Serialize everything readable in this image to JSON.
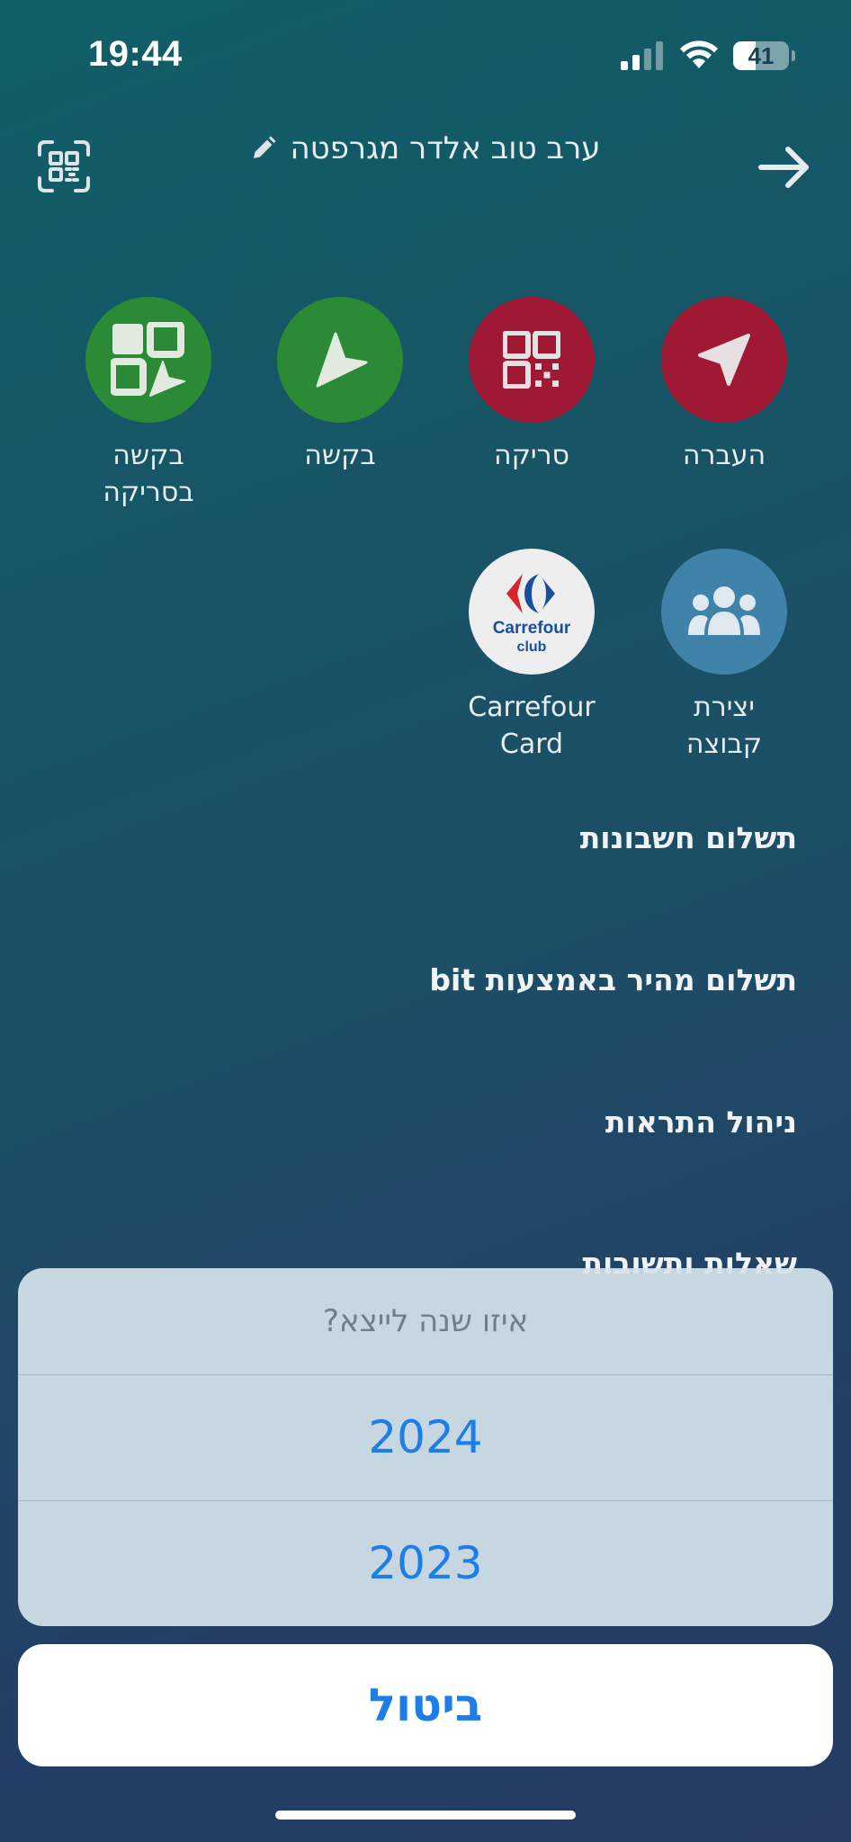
{
  "status_bar": {
    "time": "19:44",
    "battery": "41",
    "battery_level": 0.41
  },
  "header": {
    "greeting": "ערב טוב אלדר מגרפטה"
  },
  "actions": [
    {
      "label": "העברה",
      "color": "#a01934"
    },
    {
      "label": "סריקה",
      "color": "#a01934"
    },
    {
      "label": "בקשה",
      "color": "#2a8a36"
    },
    {
      "label": "בקשה\nבסריקה",
      "color": "#2a8a36"
    },
    {
      "label": "יצירת\nקבוצה",
      "color": "#3f83ab"
    },
    {
      "label": "Carrefour\nCard",
      "logo_top": "Carrefour",
      "logo_bottom": "club"
    }
  ],
  "menu": [
    {
      "label": "תשלום חשבונות"
    },
    {
      "label": "תשלום מהיר באמצעות bit"
    },
    {
      "label": "ניהול התראות"
    },
    {
      "label": "שאלות ותשובות"
    }
  ],
  "action_sheet": {
    "title": "איזו שנה לייצא?",
    "options": [
      "2024",
      "2023"
    ],
    "cancel": "ביטול",
    "accent_color": "#1e7ee8"
  }
}
